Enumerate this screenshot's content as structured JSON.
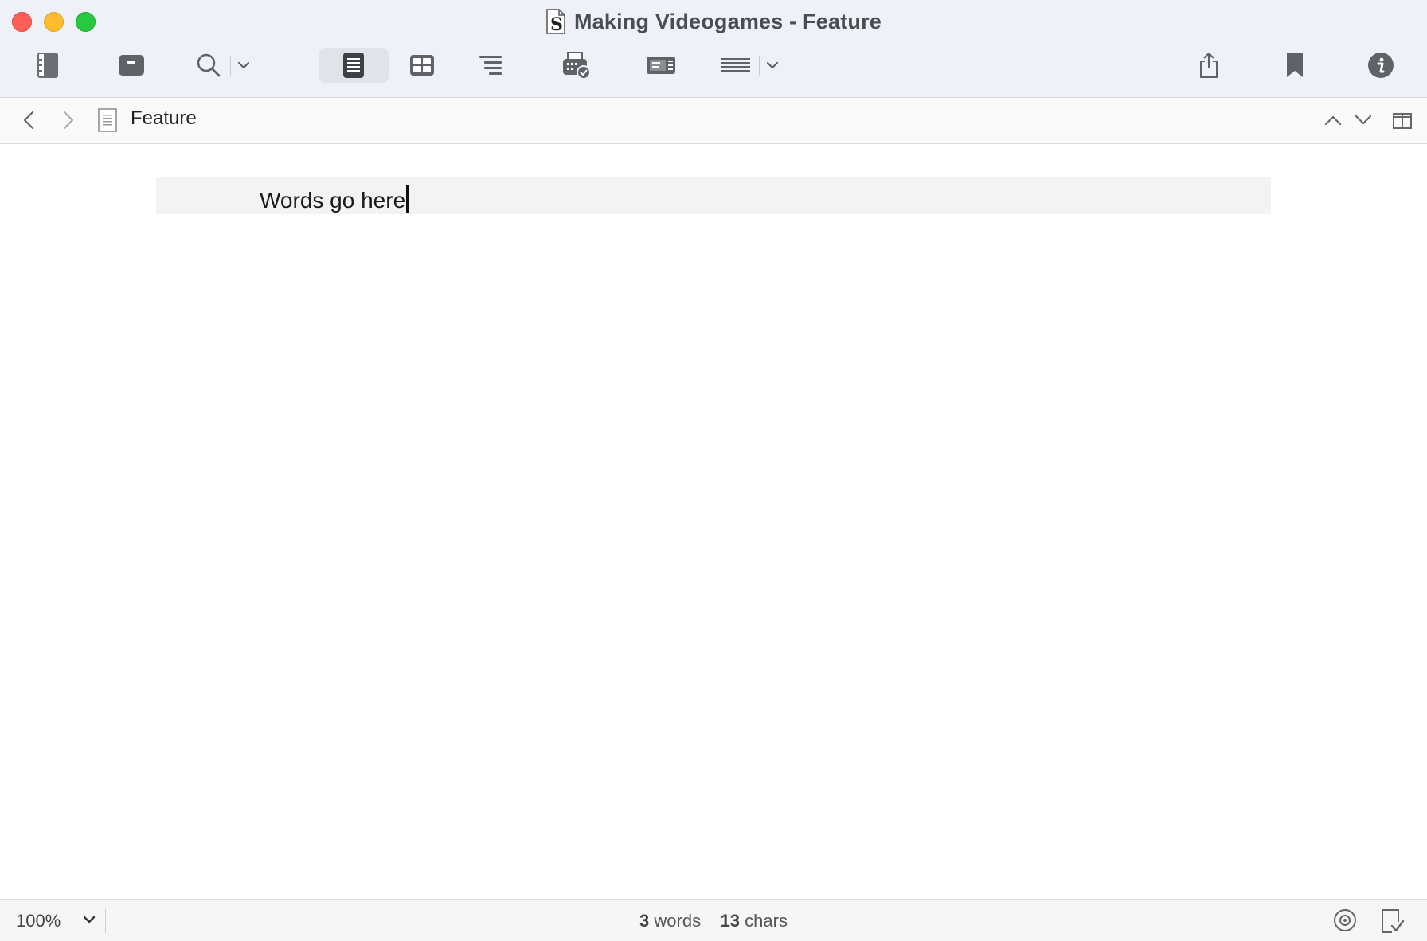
{
  "window": {
    "title": "Making Videogames - Feature"
  },
  "toolbar": {
    "items": [
      {
        "name": "binder-toggle",
        "icon": "binder-icon"
      },
      {
        "name": "quick-reference",
        "icon": "inbox-icon"
      },
      {
        "name": "search",
        "icon": "search-icon"
      },
      {
        "name": "search-options",
        "icon": "chevron-down-icon"
      },
      {
        "name": "view-editor",
        "icon": "document-view-icon",
        "pressed": true
      },
      {
        "name": "view-corkboard",
        "icon": "corkboard-icon"
      },
      {
        "name": "view-outliner",
        "icon": "outliner-icon"
      },
      {
        "name": "compile",
        "icon": "compile-icon"
      },
      {
        "name": "composition-mode",
        "icon": "composition-icon"
      },
      {
        "name": "format",
        "icon": "text-lines-icon"
      },
      {
        "name": "format-options",
        "icon": "chevron-down-icon"
      },
      {
        "name": "share",
        "icon": "share-icon"
      },
      {
        "name": "bookmarks",
        "icon": "bookmark-icon"
      },
      {
        "name": "inspector",
        "icon": "info-icon"
      }
    ]
  },
  "header": {
    "document_title": "Feature"
  },
  "editor": {
    "text": "Words go here"
  },
  "statusbar": {
    "zoom": "100%",
    "word_count": "3",
    "word_label": "words",
    "char_count": "13",
    "char_label": "chars"
  },
  "colors": {
    "close": "#fe5f57",
    "minimize": "#febc2e",
    "maximize": "#28c840",
    "toolbar_bg": "#eef2f8",
    "icon": "#5f6368"
  }
}
